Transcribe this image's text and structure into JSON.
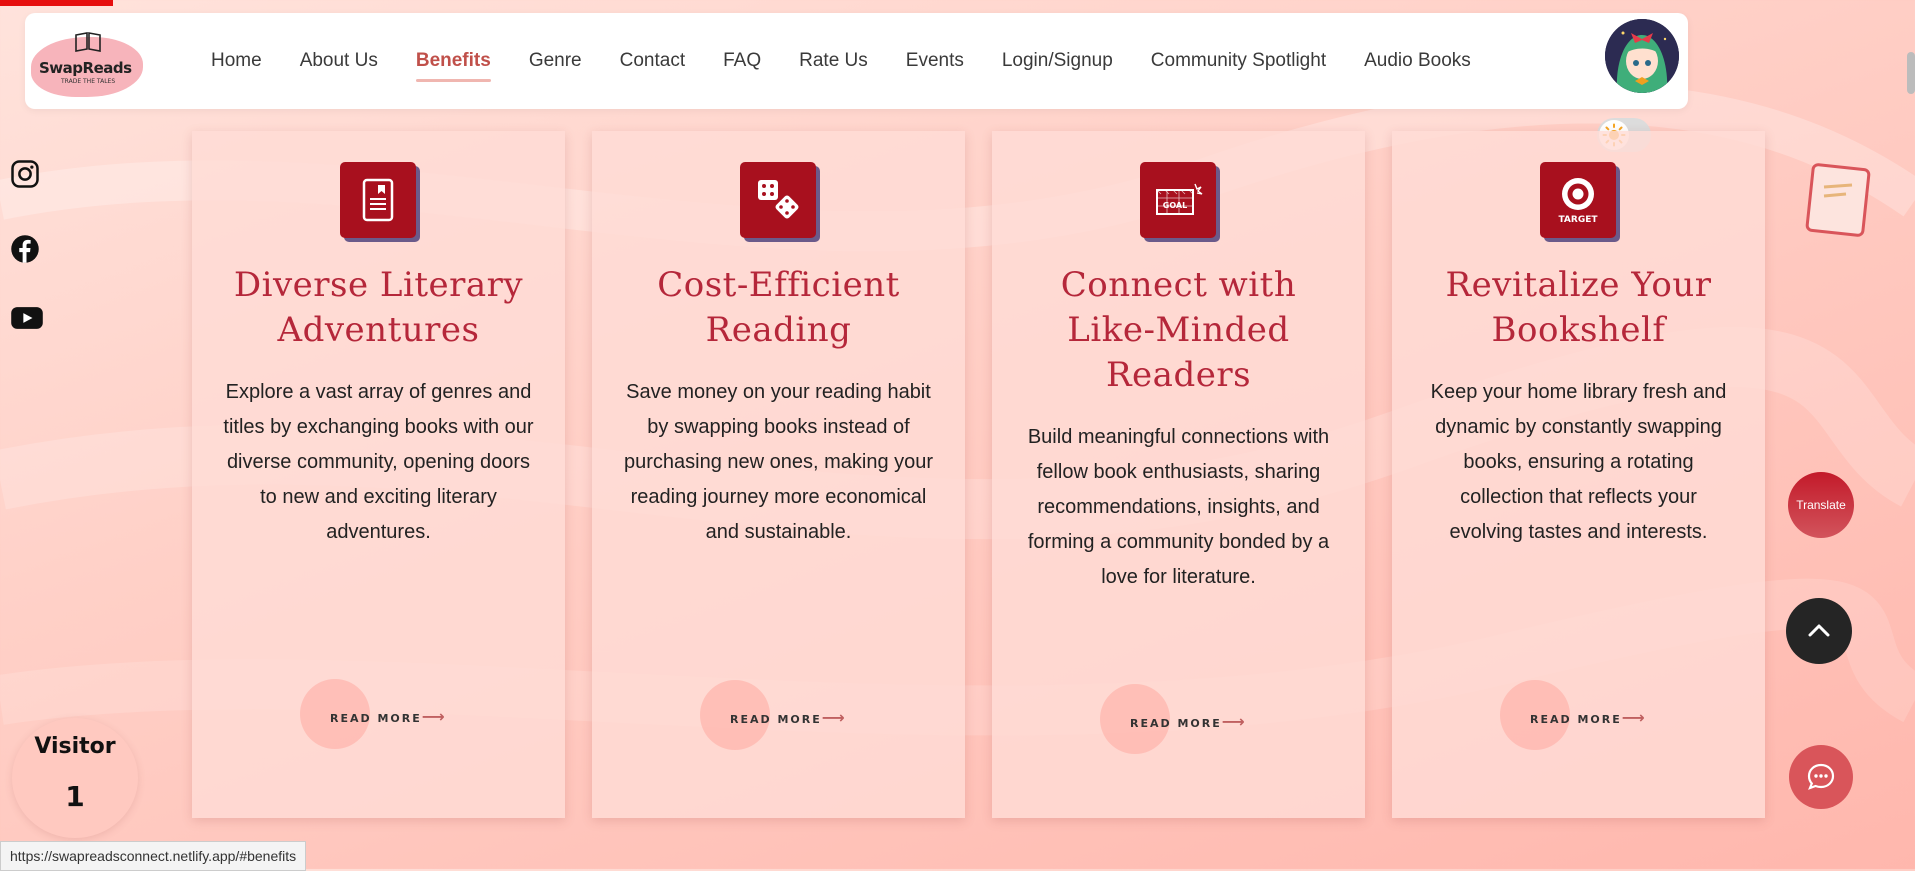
{
  "app": {
    "logo_name": "SwapReads",
    "logo_tagline": "TRADE THE TALES"
  },
  "nav": {
    "items": [
      {
        "label": "Home"
      },
      {
        "label": "About Us"
      },
      {
        "label": "Benefits",
        "active": true
      },
      {
        "label": "Genre"
      },
      {
        "label": "Contact"
      },
      {
        "label": "FAQ"
      },
      {
        "label": "Rate Us"
      },
      {
        "label": "Events"
      },
      {
        "label": "Login/Signup"
      },
      {
        "label": "Community Spotlight"
      },
      {
        "label": "Audio Books"
      }
    ]
  },
  "social": [
    "instagram-icon",
    "facebook-icon",
    "youtube-icon"
  ],
  "cards": [
    {
      "icon": "ebook-reader-icon",
      "title": "Diverse Literary Adventures",
      "text": "Explore a vast array of genres and titles by exchanging books with our diverse community, opening doors to new and exciting literary adventures.",
      "read_more": "READ MORE"
    },
    {
      "icon": "dice-icon",
      "title": "Cost-Efficient Reading",
      "text": "Save money on your reading habit by swapping books instead of purchasing new ones, making your reading journey more economical and sustainable.",
      "read_more": "READ MORE"
    },
    {
      "icon": "goal-icon",
      "icon_text": "GOAL",
      "title": "Connect with Like-Minded Readers",
      "text": "Build meaningful connections with fellow book enthusiasts, sharing recommendations, insights, and forming a community bonded by a love for literature.",
      "read_more": "READ MORE"
    },
    {
      "icon": "target-icon",
      "icon_text": "TARGET",
      "title": "Revitalize Your Bookshelf",
      "text": "Keep your home library fresh and dynamic by constantly swapping books, ensuring a rotating collection that reflects your evolving tastes and interests.",
      "read_more": "READ MORE"
    }
  ],
  "floating": {
    "translate_label": "Translate"
  },
  "visitor": {
    "label": "Visitor",
    "count": "1"
  },
  "status_url": "https://swapreadsconnect.netlify.app/#benefits",
  "colors": {
    "accent": "#b5273a",
    "icon_bg": "#a8101e",
    "active_nav": "#c0504a"
  }
}
